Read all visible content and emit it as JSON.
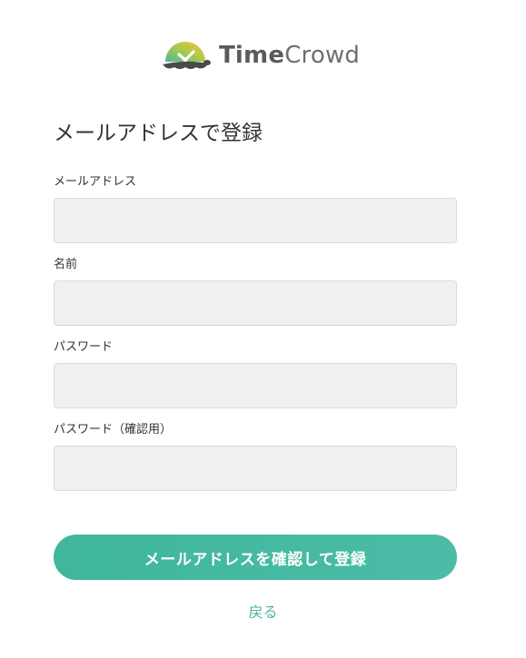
{
  "brand": {
    "logo_icon": "turtle-clock-logo",
    "name_part1": "Time",
    "name_part2": "Crowd",
    "accent_color": "#4cbca6"
  },
  "page_title": "メールアドレスで登録",
  "fields": {
    "email": {
      "label": "メールアドレス",
      "value": ""
    },
    "name": {
      "label": "名前",
      "value": ""
    },
    "password": {
      "label": "パスワード",
      "value": ""
    },
    "password_confirm": {
      "label": "パスワード（確認用）",
      "value": ""
    }
  },
  "submit_label": "メールアドレスを確認して登録",
  "back_label": "戻る"
}
